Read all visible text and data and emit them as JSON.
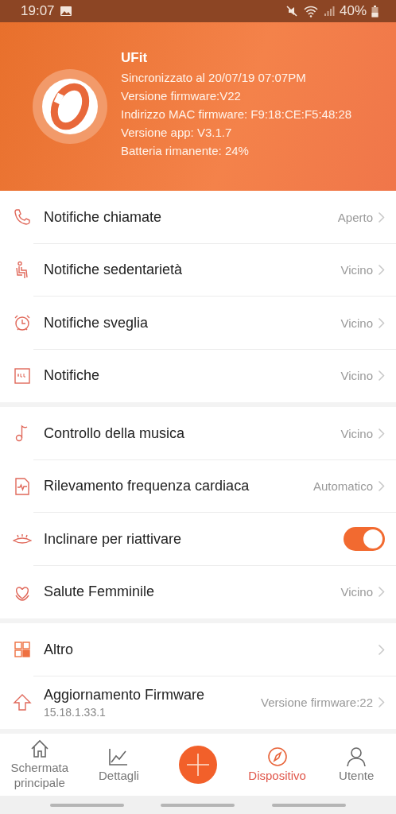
{
  "status_bar": {
    "time": "19:07",
    "battery": "40%"
  },
  "device": {
    "name": "UFit",
    "info": [
      "Sincronizzato al 20/07/19 07:07PM",
      "Versione firmware:V22",
      "Indirizzo MAC firmware: F9:18:CE:F5:48:28",
      "Versione app: V3.1.7",
      "Batteria rimanente: 24%"
    ]
  },
  "sections": [
    {
      "items": [
        {
          "kind": "link",
          "label": "Notifiche chiamate",
          "value": "Aperto"
        },
        {
          "kind": "link",
          "label": "Notifiche sedentarietà",
          "value": "Vicino"
        },
        {
          "kind": "link",
          "label": "Notifiche sveglia",
          "value": "Vicino"
        },
        {
          "kind": "link",
          "label": "Notifiche",
          "value": "Vicino"
        }
      ]
    },
    {
      "items": [
        {
          "kind": "link",
          "label": "Controllo della musica",
          "value": "Vicino"
        },
        {
          "kind": "link",
          "label": "Rilevamento frequenza cardiaca",
          "value": "Automatico"
        },
        {
          "kind": "toggle",
          "label": "Inclinare per riattivare",
          "on": true
        },
        {
          "kind": "link",
          "label": "Salute Femminile",
          "value": "Vicino"
        }
      ]
    },
    {
      "items": [
        {
          "kind": "link",
          "label": "Altro"
        },
        {
          "kind": "link",
          "label": "Aggiornamento Firmware",
          "sublabel": "15.18.1.33.1",
          "value": "Versione firmware:22"
        }
      ]
    }
  ],
  "nav": [
    {
      "kind": "tab",
      "label": "Schermata principale",
      "selected": false
    },
    {
      "kind": "tab",
      "label": "Dettagli",
      "selected": false
    },
    {
      "kind": "add"
    },
    {
      "kind": "tab",
      "label": "Dispositivo",
      "selected": true
    },
    {
      "kind": "tab",
      "label": "Utente",
      "selected": false
    }
  ]
}
